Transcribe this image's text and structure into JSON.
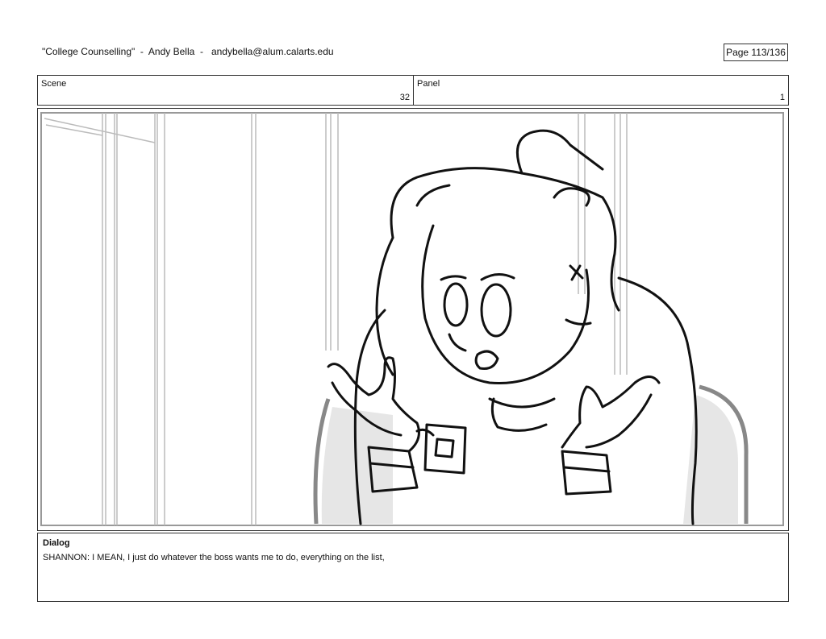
{
  "header": {
    "title": "\"College Counselling\"  -  Andy Bella  -   andybella@alum.calarts.edu",
    "page": "Page 113/136"
  },
  "info": {
    "scene_label": "Scene",
    "scene_value": "32",
    "panel_label": "Panel",
    "panel_value": "1"
  },
  "dialog": {
    "label": "Dialog",
    "text": "SHANNON: I MEAN, I just do whatever the boss wants me to do, everything on the list,"
  }
}
